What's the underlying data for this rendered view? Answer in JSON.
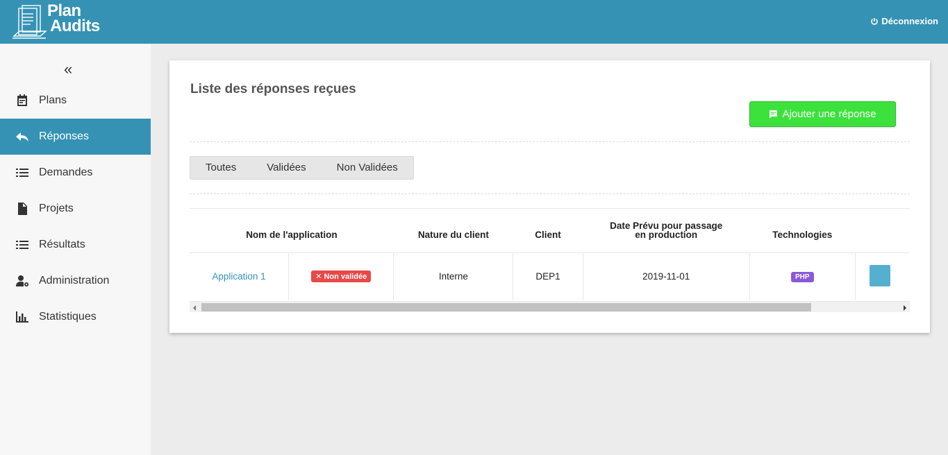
{
  "brand": {
    "line1": "Plan",
    "line2": "Audits"
  },
  "header": {
    "logout_label": "Déconnexion"
  },
  "sidebar": {
    "collapse_icon": "«",
    "items": [
      {
        "label": "Plans",
        "icon": "calendar-icon"
      },
      {
        "label": "Réponses",
        "icon": "reply-icon",
        "active": true
      },
      {
        "label": "Demandes",
        "icon": "list-icon"
      },
      {
        "label": "Projets",
        "icon": "document-icon"
      },
      {
        "label": "Résultats",
        "icon": "list-icon"
      },
      {
        "label": "Administration",
        "icon": "user-settings-icon"
      },
      {
        "label": "Statistiques",
        "icon": "bar-chart-icon"
      }
    ]
  },
  "main": {
    "title": "Liste des réponses reçues",
    "add_button_label": "Ajouter une réponse",
    "filters": [
      "Toutes",
      "Validées",
      "Non Validées"
    ],
    "table": {
      "headers": [
        "Nom de l'application",
        "Nature du client",
        "Client",
        "Date Prévu pour passage en production",
        "Technologies"
      ],
      "header_line1": "Date Prévu pour passage",
      "header_line2": "en production",
      "rows": [
        {
          "name": "Application 1",
          "status": "Non validée",
          "nature": "Interne",
          "client": "DEP1",
          "date": "2019-11-01",
          "tech": "PHP"
        }
      ]
    }
  },
  "colors": {
    "primary": "#3592b5",
    "success": "#3ce13c",
    "danger": "#e84848",
    "php": "#8a5ad6"
  }
}
